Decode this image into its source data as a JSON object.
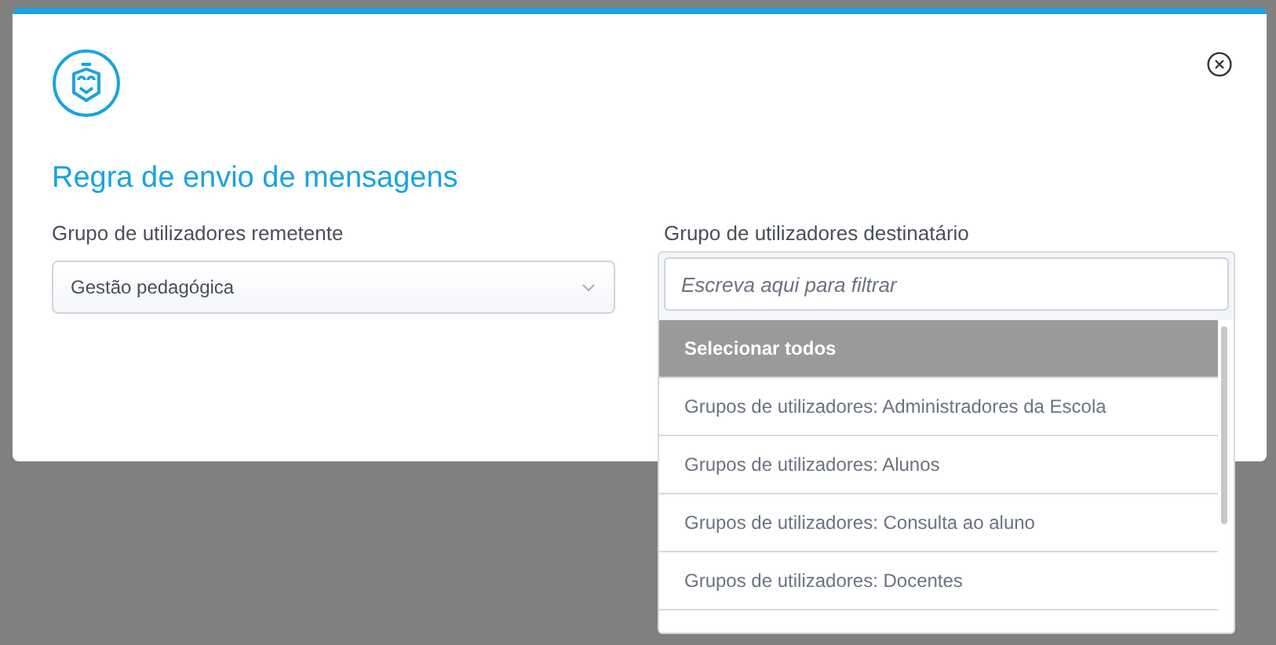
{
  "dialog": {
    "title": "Regra de envio de mensagens"
  },
  "sender": {
    "label": "Grupo de utilizadores remetente",
    "value": "Gestão pedagógica"
  },
  "recipient": {
    "label": "Grupo de utilizadores destinatário",
    "filter": {
      "placeholder": "Escreva aqui para filtrar"
    },
    "options": [
      {
        "label": "Selecionar todos",
        "selected": true
      },
      {
        "label": "Grupos de utilizadores: Administradores da Escola",
        "selected": false
      },
      {
        "label": "Grupos de utilizadores: Alunos",
        "selected": false
      },
      {
        "label": "Grupos de utilizadores: Consulta ao aluno",
        "selected": false
      },
      {
        "label": "Grupos de utilizadores: Docentes",
        "selected": false
      }
    ]
  }
}
